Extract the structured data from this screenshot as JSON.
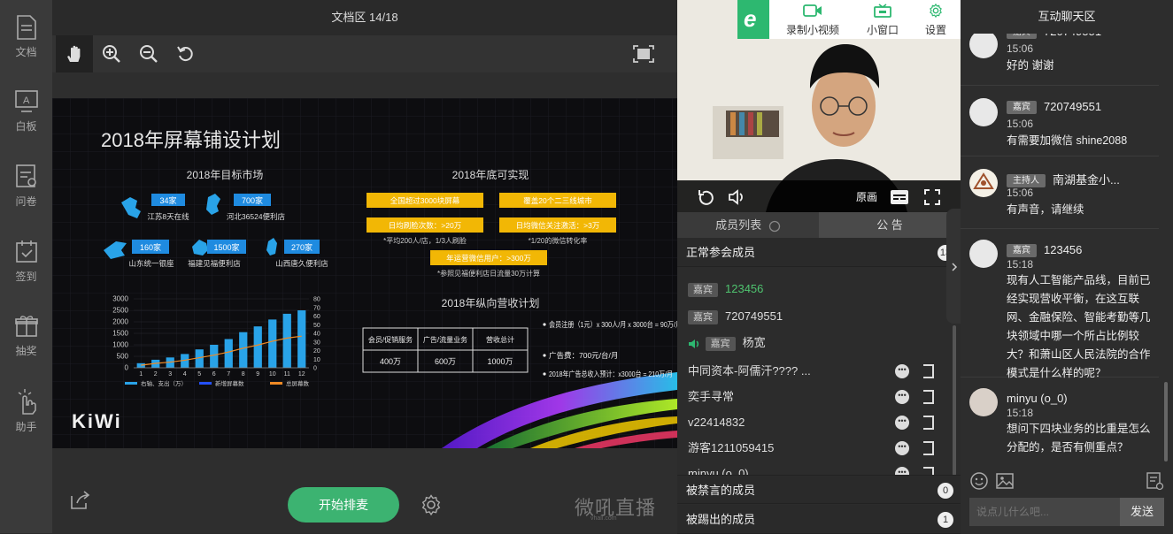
{
  "rail": [
    {
      "label": "文档",
      "icon": "document-icon"
    },
    {
      "label": "白板",
      "icon": "whiteboard-icon"
    },
    {
      "label": "问卷",
      "icon": "survey-icon"
    },
    {
      "label": "签到",
      "icon": "checkin-icon"
    },
    {
      "label": "抽奖",
      "icon": "gift-icon"
    },
    {
      "label": "助手",
      "icon": "hand-pointer-icon"
    }
  ],
  "doc": {
    "title": "文档区 14/18"
  },
  "slide": {
    "title": "2018年屏幕铺设计划",
    "left_heading": "2018年目标市场",
    "right_heading": "2018年底可实现",
    "markets": [
      {
        "count": "34家",
        "label": "江苏8天在线"
      },
      {
        "count": "700家",
        "label": "河北36524便利店"
      },
      {
        "count": "160家",
        "label": "山东统一银座"
      },
      {
        "count": "1500家",
        "label": "福建见福便利店"
      },
      {
        "count": "270家",
        "label": "山西唐久便利店"
      }
    ],
    "goals": [
      "全国超过3000块屏幕",
      "覆盖20个二三线城市",
      "日均刷脸次数：>20万",
      "日均微信关注激活：>3万",
      "年运营微信用户：>300万"
    ],
    "notes": [
      "*平均200人/店，1/3人刷脸",
      "*1/20的微信转化率",
      "*参照见福便利店日流量30万计算"
    ],
    "revenue_heading": "2018年纵向营收计划",
    "table_headers": [
      "会员/促销服务",
      "广告/流量业务",
      "营收总计"
    ],
    "table_values": [
      "400万",
      "600万",
      "1000万"
    ],
    "bullets": [
      "会员注册（1元）x 300人/月 x 3000台 = 90万/月",
      "广告费：700元/台/月",
      "2018年广告总收入预计：x3000台 = 210万/月"
    ],
    "logo": "KiWi",
    "chart_legend": [
      "右轴、支出（万）",
      "新增屏幕数",
      "总屏幕数"
    ],
    "chart_data": {
      "type": "bar",
      "categories": [
        "1",
        "2",
        "3",
        "4",
        "5",
        "6",
        "7",
        "8",
        "9",
        "10",
        "11",
        "12"
      ],
      "series": [
        {
          "values": [
            200,
            350,
            450,
            600,
            800,
            1000,
            1250,
            1550,
            1800,
            2100,
            2350,
            2500
          ]
        }
      ],
      "ylim": [
        0,
        3000
      ],
      "yticks": [
        "0",
        "500",
        "1000",
        "1500",
        "2000",
        "2500",
        "3000"
      ],
      "y2ticks": [
        "0",
        "10",
        "20",
        "30",
        "40",
        "50",
        "60",
        "70",
        "80"
      ]
    }
  },
  "bottom": {
    "start_label": "开始排麦",
    "brand": "微吼直播",
    "brand_url": "vhall.com"
  },
  "video": {
    "record_label": "录制小视频",
    "window_label": "小窗口",
    "settings_label": "设置",
    "quality_label": "原画"
  },
  "members": {
    "tab_list": "成员列表",
    "tab_notice": "公 告",
    "normal_label": "正常参会成员",
    "normal_count": "13",
    "list": [
      {
        "tag": "嘉宾",
        "name": "123456",
        "color": "#4fc36f"
      },
      {
        "tag": "嘉宾",
        "name": "720749551",
        "color": "#dddddd"
      },
      {
        "tag": "嘉宾",
        "name": "杨宽",
        "color": "#dddddd"
      },
      {
        "tag": "",
        "name": "中同资本-阿儒汗???? ...",
        "color": "#dddddd"
      },
      {
        "tag": "",
        "name": "奕手寻常",
        "color": "#dddddd"
      },
      {
        "tag": "",
        "name": "v22414832",
        "color": "#dddddd"
      },
      {
        "tag": "",
        "name": "游客1211059415",
        "color": "#dddddd"
      },
      {
        "tag": "",
        "name": "minyu (o_0)",
        "color": "#dddddd"
      }
    ],
    "muted_label": "被禁言的成员",
    "muted_count": "0",
    "kicked_label": "被踢出的成员",
    "kicked_count": "1"
  },
  "chat": {
    "title": "互动聊天区",
    "messages": [
      {
        "tag": "嘉宾",
        "name": "720749551",
        "time": "15:06",
        "text": "好的 谢谢"
      },
      {
        "tag": "嘉宾",
        "name": "720749551",
        "time": "15:06",
        "text": "有需要加微信 shine2088"
      },
      {
        "tag": "主持人",
        "name": "南湖基金小...",
        "time": "15:06",
        "text": "有声音，请继续"
      },
      {
        "tag": "嘉宾",
        "name": "123456",
        "time": "15:18",
        "text": "现有人工智能产品线，目前已经实现营收平衡，在这互联网、金融保险、智能考勤等几块领域中哪一个所占比例较大？和萧山区人民法院的合作模式是什么样的呢？"
      },
      {
        "tag": "",
        "name": "minyu (o_0)",
        "time": "15:18",
        "text": "想问下四块业务的比重是怎么分配的，是否有侧重点？"
      }
    ],
    "placeholder": "说点儿什么吧...",
    "send_label": "发送"
  }
}
